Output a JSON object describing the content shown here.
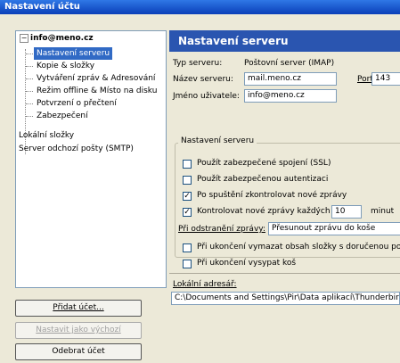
{
  "window": {
    "title": "Nastavení účtu"
  },
  "tree": {
    "account": "info@meno.cz",
    "account_items": [
      "Nastavení serveru",
      "Kopie & složky",
      "Vytváření zpráv & Adresování",
      "Režim offline & Místo na disku",
      "Potvrzení o přečtení",
      "Zabezpečení"
    ],
    "local_folders": "Lokální složky",
    "smtp": "Server odchozí pošty (SMTP)"
  },
  "buttons": {
    "add_account": "Přidat účet...",
    "set_default": "Nastavit jako výchozí",
    "remove_account": "Odebrat účet"
  },
  "panel": {
    "title": "Nastavení serveru",
    "server_type_label": "Typ serveru:",
    "server_type_value": "Poštovní server (IMAP)",
    "server_name_label": "Název serveru:",
    "server_name_value": "mail.meno.cz",
    "port_label": "Port:",
    "port_value": "143",
    "username_label": "Jméno uživatele:",
    "username_value": "info@meno.cz",
    "group_title": "Nastavení serveru",
    "ssl": "Použít zabezpečené spojení (SSL)",
    "secure_auth": "Použít zabezpečenou autentizaci",
    "check_startup": "Po spuštění zkontrolovat nové zprávy",
    "check_every": "Kontrolovat nové zprávy každých",
    "check_every_value": "10",
    "minutes": "minut",
    "on_delete_label": "Při odstranění zprávy:",
    "on_delete_value": "Přesunout zprávu do koše",
    "expunge": "Při ukončení vymazat obsah složky s doručenou poštou",
    "empty_trash": "Při ukončení vysypat koš",
    "local_dir_label": "Lokální adresář:",
    "local_dir_value": "C:\\Documents and Settings\\Pir\\Data aplikací\\Thunderbird\\P"
  }
}
